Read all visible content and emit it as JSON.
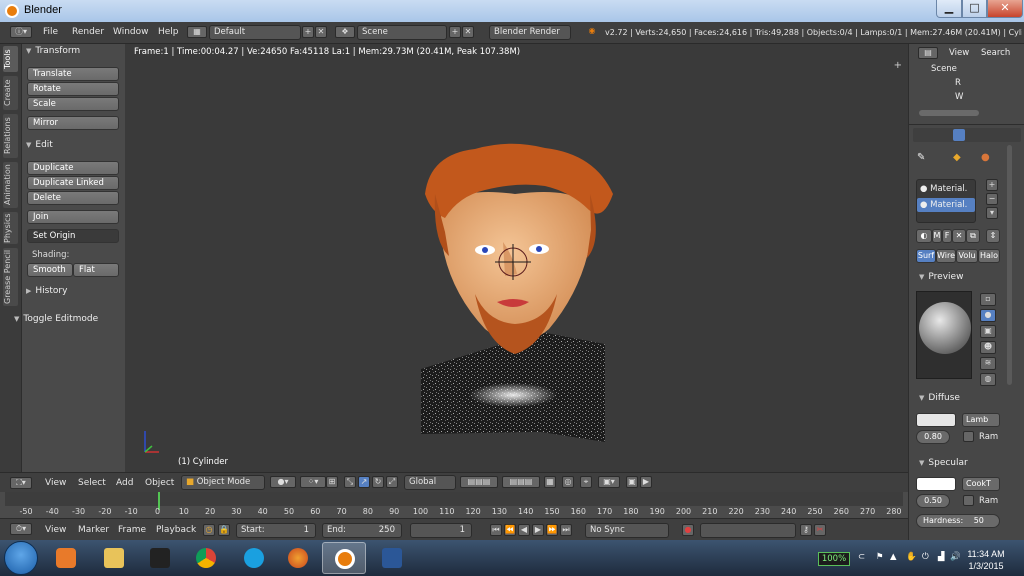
{
  "window": {
    "title": "Blender",
    "min_label": "▁",
    "max_label": "□",
    "close_label": "✕"
  },
  "infobar": {
    "menus": [
      "File",
      "Render",
      "Window",
      "Help"
    ],
    "layout": "Default",
    "scene": "Scene",
    "engine": "Blender Render",
    "stats": "v2.72 | Verts:24,650 | Faces:24,616 | Tris:49,288 | Objects:0/4 | Lamps:0/1 | Mem:27.46M (20.41M) | Cylinder"
  },
  "toolshelf": {
    "tabs": [
      "Tools",
      "Create",
      "Relations",
      "Animation",
      "Physics",
      "Grease Pencil"
    ],
    "transform": {
      "header": "Transform",
      "buttons": [
        "Translate",
        "Rotate",
        "Scale",
        "Mirror"
      ]
    },
    "edit": {
      "header": "Edit",
      "buttons": [
        "Duplicate",
        "Duplicate Linked",
        "Delete",
        "Join"
      ],
      "set_origin": "Set Origin",
      "shading_label": "Shading:",
      "smooth": "Smooth",
      "flat": "Flat"
    },
    "history": "History",
    "toggle_editmode": "Toggle Editmode"
  },
  "viewport": {
    "info": "Frame:1 | Time:00:04.27 | Ve:24650 Fa:45118 La:1 | Mem:29.73M (20.41M, Peak 107.38M)",
    "object_label": "(1) Cylinder"
  },
  "outliner": {
    "view": "View",
    "search": "Search",
    "items": [
      "Scene",
      "R",
      "W"
    ]
  },
  "properties": {
    "materials": [
      "Material.",
      "Material."
    ],
    "tabs": [
      "Surf",
      "Wire",
      "Volu",
      "Halo"
    ],
    "preview": "Preview",
    "diffuse": {
      "header": "Diffuse",
      "shader": "Lamb",
      "intensity": "0.80",
      "ramp": "Ram"
    },
    "specular": {
      "header": "Specular",
      "shader": "CookT",
      "intensity": "0.50",
      "ramp": "Ram",
      "hardness": "Hardness:",
      "hardness_value": "50"
    },
    "mini_labels": [
      "M",
      "F"
    ]
  },
  "vp_header": {
    "menus": [
      "View",
      "Select",
      "Add",
      "Object"
    ],
    "mode": "Object Mode",
    "orientation": "Global"
  },
  "timeline": {
    "ticks": [
      "-50",
      "-40",
      "-30",
      "-20",
      "-10",
      "0",
      "10",
      "20",
      "30",
      "40",
      "50",
      "60",
      "70",
      "80",
      "90",
      "100",
      "110",
      "120",
      "130",
      "140",
      "150",
      "160",
      "170",
      "180",
      "190",
      "200",
      "210",
      "220",
      "230",
      "240",
      "250",
      "260",
      "270",
      "280"
    ],
    "current_frame": 0,
    "menus": [
      "View",
      "Marker",
      "Frame",
      "Playback"
    ],
    "start_label": "Start:",
    "start_value": "1",
    "end_label": "End:",
    "end_value": "250",
    "frame_value": "1",
    "sync": "No Sync"
  },
  "taskbar": {
    "battery": "100%",
    "time": "11:34 AM",
    "date": "1/3/2015"
  },
  "colors": {
    "accent": "#5680c2",
    "hair": "#c2581c",
    "skin": "#e9b07c",
    "playhead": "#53c553"
  }
}
